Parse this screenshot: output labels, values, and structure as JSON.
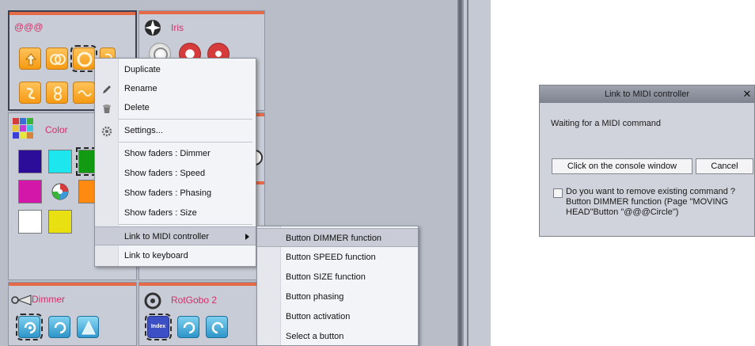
{
  "panels": {
    "preset1": {
      "title": "@@@"
    },
    "iris": {
      "title": "Iris"
    },
    "color": {
      "title": "Color",
      "swatches": [
        "#2b0d9a",
        "#1ee6ee",
        "#139a13",
        "#d317a9",
        "",
        "#ff8a12",
        "#ffffff",
        "#e8e010"
      ]
    },
    "dimmer": {
      "title": "Dimmer"
    },
    "rotgobo": {
      "title": "RotGobo 2",
      "index_label": "Index"
    }
  },
  "context_menu": {
    "items": [
      {
        "label": "Duplicate",
        "icon": "none"
      },
      {
        "label": "Rename",
        "icon": "pencil-icon"
      },
      {
        "label": "Delete",
        "icon": "trash-icon"
      },
      {
        "label": "Settings...",
        "icon": "gear-icon"
      },
      {
        "label": "Show faders : Dimmer"
      },
      {
        "label": "Show faders : Speed"
      },
      {
        "label": "Show faders : Phasing"
      },
      {
        "label": "Show faders : Size"
      },
      {
        "label": "Link to MIDI controller",
        "highlighted": true,
        "has_submenu": true
      },
      {
        "label": "Link to keyboard"
      }
    ]
  },
  "submenu": {
    "items": [
      {
        "label": "Button DIMMER function",
        "highlighted": true
      },
      {
        "label": "Button SPEED function"
      },
      {
        "label": "Button SIZE function"
      },
      {
        "label": "Button phasing"
      },
      {
        "label": "Button activation"
      },
      {
        "label": "Select a button"
      }
    ]
  },
  "dialog": {
    "title": "Link to MIDI controller",
    "close_glyph": "✕",
    "waiting_text": "Waiting for a MIDI command",
    "console_button": "Click on the console window",
    "cancel_button": "Cancel",
    "remove_question": "Do you want to remove existing command ?",
    "existing_command_line1": "Button DIMMER function (Page \"MOVING",
    "existing_command_line2": "HEAD\"Button \"@@@Circle\")"
  },
  "colors": {
    "panel_title": "#d1306a",
    "accent_bar": "#e56a47",
    "orange_button": "#f59a12",
    "blue_button": "#2d95c9"
  }
}
